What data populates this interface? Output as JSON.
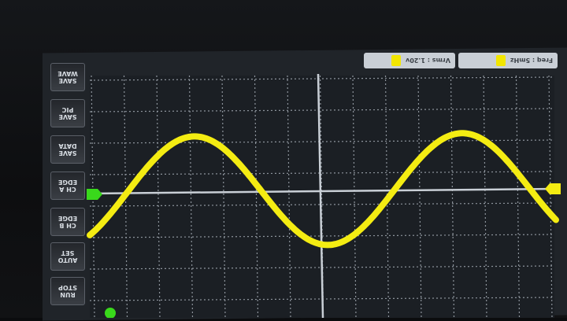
{
  "top_tags": [
    {
      "label": "Vrms : 1.20v",
      "swatch": "#f2e600"
    },
    {
      "label": "Freq : 5mHz",
      "swatch": "#f2e600"
    }
  ],
  "side_buttons": [
    {
      "line1": "SAVE",
      "line2": "WAVE"
    },
    {
      "line1": "SAVE",
      "line2": "PIC"
    },
    {
      "line1": "SAVE",
      "line2": "DATA"
    },
    {
      "line1": "CH A",
      "line2": "EDGE"
    },
    {
      "line1": "CH B",
      "line2": "EDGE"
    },
    {
      "line1": "AUTO",
      "line2": "SET"
    },
    {
      "line1": "RUN",
      "line2": "STOP"
    }
  ],
  "trace_color": "#f4ec12",
  "trigger_marker_color": "#39d91b",
  "grid_color": "#8d949c"
}
